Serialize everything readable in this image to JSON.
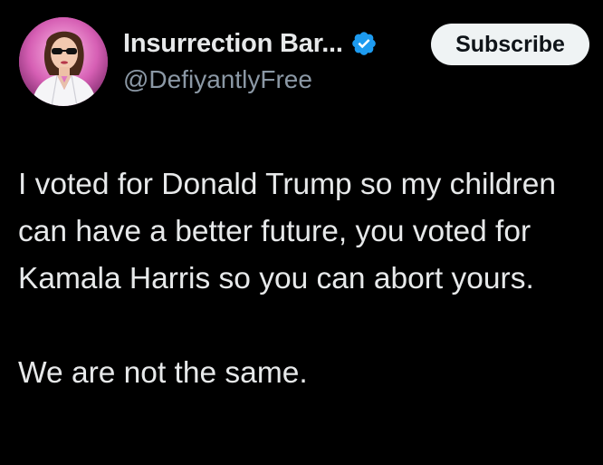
{
  "post": {
    "author": {
      "display_name": "Insurrection Bar...",
      "handle": "@DefiyantlyFree",
      "verified": true,
      "verified_icon": "verified-badge-icon",
      "avatar": "profile-photo"
    },
    "subscribe_label": "Subscribe",
    "text_paragraphs": [
      "I voted for Donald Trump so my children can have a better future, you voted for Kamala Harris so you can abort yours.",
      "We are not the same."
    ]
  },
  "colors": {
    "background": "#000000",
    "text_primary": "#e7e9ea",
    "text_secondary": "#8b98a5",
    "verified_blue": "#1d9bf0",
    "button_bg": "#eff3f4",
    "button_text": "#0f1419"
  }
}
